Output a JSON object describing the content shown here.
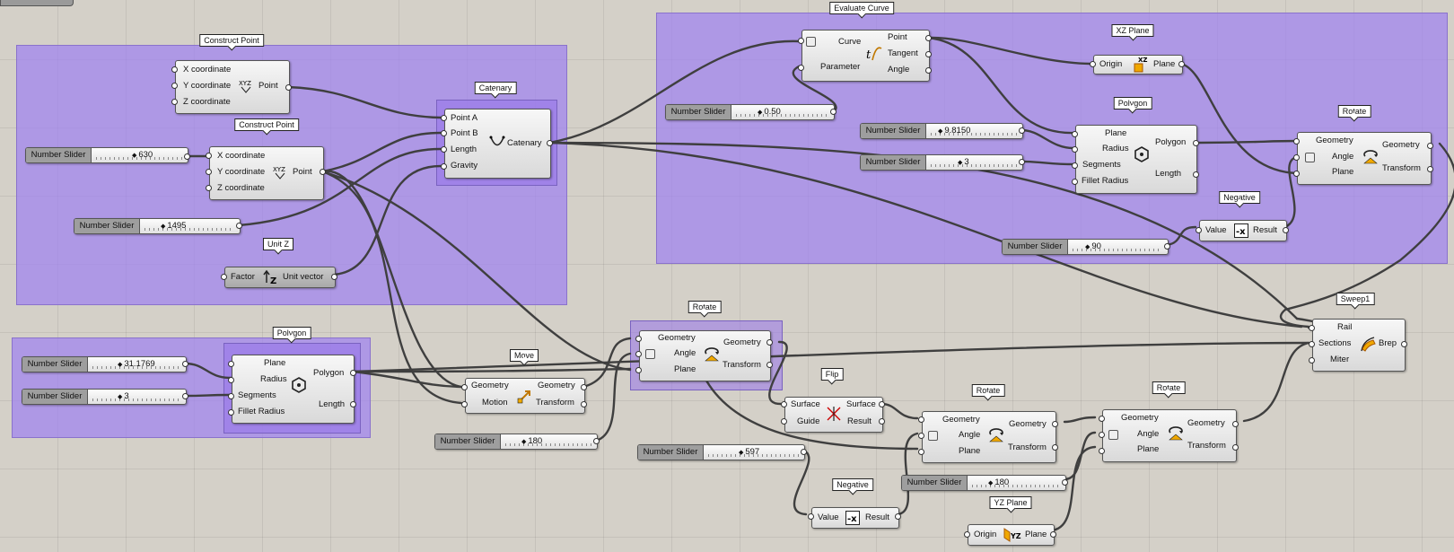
{
  "groups": {
    "construct_point": "Construct Point",
    "construct_point_2": "Construct Point",
    "catenary": "Catenary",
    "unit_z": "Unit Z",
    "polygon_left": "Polygon",
    "evaluate_curve": "Evaluate Curve",
    "xz_plane": "XZ Plane",
    "polygon_right": "Polygon",
    "rotate_right": "Rotate",
    "negative_top": "Negative",
    "rotate_mid": "Rotate",
    "move": "Move",
    "flip": "Flip",
    "rotate_low1": "Rotate",
    "rotate_low2": "Rotate",
    "negative_low": "Negative",
    "yz_plane": "YZ Plane",
    "sweep1": "Sweep1"
  },
  "nodes": {
    "cp1": {
      "in": [
        "X coordinate",
        "Y coordinate",
        "Z coordinate"
      ],
      "out": [
        "Point"
      ]
    },
    "cp2": {
      "in": [
        "X coordinate",
        "Y coordinate",
        "Z coordinate"
      ],
      "out": [
        "Point"
      ]
    },
    "catenary": {
      "in": [
        "Point A",
        "Point B",
        "Length",
        "Gravity"
      ],
      "out": [
        "Catenary"
      ]
    },
    "unitz": {
      "in": [
        "Factor"
      ],
      "out": [
        "Unit vector"
      ]
    },
    "polygon_left": {
      "in": [
        "Plane",
        "Radius",
        "Segments",
        "Fillet Radius"
      ],
      "out": [
        "Polygon",
        "Length"
      ]
    },
    "move": {
      "in": [
        "Geometry",
        "Motion"
      ],
      "out": [
        "Geometry",
        "Transform"
      ]
    },
    "rotate_mid": {
      "in": [
        "Geometry",
        "Angle",
        "Plane"
      ],
      "out": [
        "Geometry",
        "Transform"
      ]
    },
    "evalcurve": {
      "in": [
        "Curve",
        "Parameter"
      ],
      "out": [
        "Point",
        "Tangent",
        "Angle"
      ]
    },
    "xzplane": {
      "in": [
        "Origin"
      ],
      "out": [
        "Plane"
      ]
    },
    "polygon_right": {
      "in": [
        "Plane",
        "Radius",
        "Segments",
        "Fillet Radius"
      ],
      "out": [
        "Polygon",
        "Length"
      ]
    },
    "rotate_right": {
      "in": [
        "Geometry",
        "Angle",
        "Plane"
      ],
      "out": [
        "Geometry",
        "Transform"
      ]
    },
    "negative_top": {
      "in": [
        "Value"
      ],
      "out": [
        "Result"
      ]
    },
    "flip": {
      "in": [
        "Surface",
        "Guide"
      ],
      "out": [
        "Surface",
        "Result"
      ]
    },
    "rotate_low1": {
      "in": [
        "Geometry",
        "Angle",
        "Plane"
      ],
      "out": [
        "Geometry",
        "Transform"
      ]
    },
    "rotate_low2": {
      "in": [
        "Geometry",
        "Angle",
        "Plane"
      ],
      "out": [
        "Geometry",
        "Transform"
      ]
    },
    "negative_low": {
      "in": [
        "Value"
      ],
      "out": [
        "Result"
      ]
    },
    "yzplane": {
      "in": [
        "Origin"
      ],
      "out": [
        "Plane"
      ]
    },
    "sweep1": {
      "in": [
        "Rail",
        "Sections",
        "Miter"
      ],
      "out": [
        "Brep"
      ]
    }
  },
  "sliders": {
    "s630": {
      "label": "Number Slider",
      "value": "630"
    },
    "s1495": {
      "label": "Number Slider",
      "value": "1495"
    },
    "s31": {
      "label": "Number Slider",
      "value": "31.1769"
    },
    "s3a": {
      "label": "Number Slider",
      "value": "3"
    },
    "s180a": {
      "label": "Number Slider",
      "value": "180"
    },
    "s050": {
      "label": "Number Slider",
      "value": "0.50"
    },
    "s9815": {
      "label": "Number Slider",
      "value": "9.8150"
    },
    "s3b": {
      "label": "Number Slider",
      "value": "3"
    },
    "s90": {
      "label": "Number Slider",
      "value": "90"
    },
    "s597": {
      "label": "Number Slider",
      "value": "597"
    },
    "s180b": {
      "label": "Number Slider",
      "value": "180"
    }
  },
  "colors": {
    "canvas": "#d4d0c8",
    "group_fill": "#a082f0",
    "wire": "#444444",
    "icon_accent": "#f0a800"
  }
}
